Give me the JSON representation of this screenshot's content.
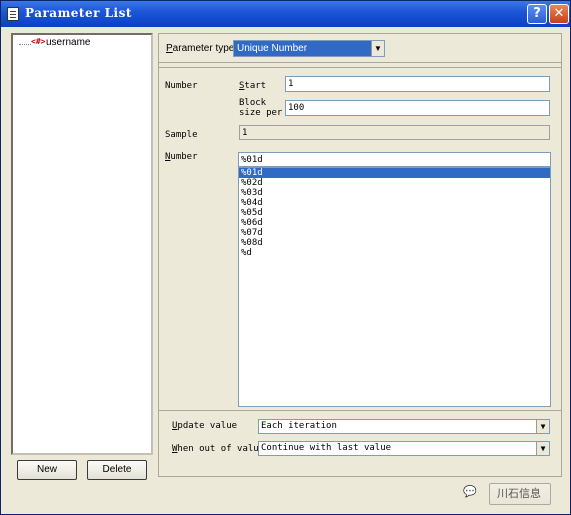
{
  "window": {
    "title": "Parameter List"
  },
  "tree": {
    "items": [
      {
        "icon": "<#>",
        "label": "username"
      }
    ]
  },
  "left_buttons": {
    "new": "New",
    "delete": "Delete"
  },
  "param_type": {
    "label": "Parameter type:",
    "value": "Unique Number"
  },
  "number": {
    "label": "Number",
    "start_label": "Start",
    "start_value": "1",
    "block_label": "Block size per",
    "block_value": "100"
  },
  "sample": {
    "label": "Sample",
    "value": "1"
  },
  "format": {
    "label": "Number",
    "value": "%01d",
    "options": [
      "%01d",
      "%02d",
      "%03d",
      "%04d",
      "%05d",
      "%06d",
      "%07d",
      "%08d",
      "%d"
    ],
    "selected_index": 0
  },
  "update": {
    "label": "Update value",
    "value": "Each iteration"
  },
  "out_of_values": {
    "label": "When out of values",
    "value": "Continue with last value"
  },
  "watermark": {
    "text": "川石信息"
  },
  "colors": {
    "titlebar": "#0b3fc6",
    "selection": "#316ac5",
    "dialog": "#ece9d8"
  }
}
